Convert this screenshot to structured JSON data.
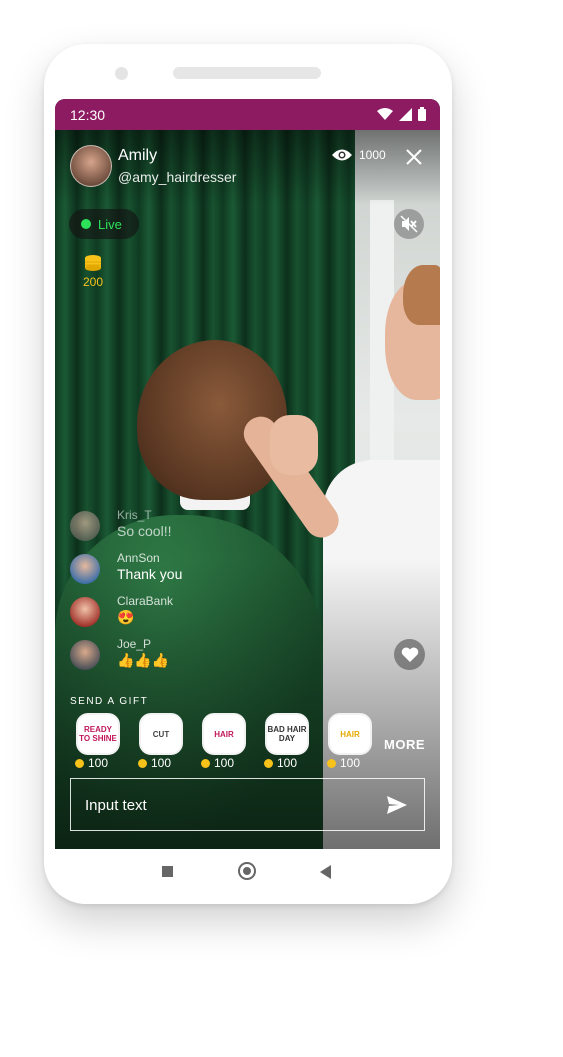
{
  "status_bar": {
    "time": "12:30"
  },
  "streamer": {
    "name": "Amily",
    "handle": "@amy_hairdresser"
  },
  "viewers": {
    "count": "1000",
    "icon": "eye-icon"
  },
  "live_badge": {
    "label": "Live",
    "color": "#2de25a"
  },
  "coins": {
    "amount": "200",
    "icon": "coin-stack-icon",
    "color": "#f7c21a"
  },
  "chat": [
    {
      "user": "Kris_T",
      "message": "So cool!!"
    },
    {
      "user": "AnnSon",
      "message": "Thank you"
    },
    {
      "user": "ClaraBank",
      "message": "😍"
    },
    {
      "user": "Joe_P",
      "message": "👍👍👍"
    }
  ],
  "gifts": {
    "title": "SEND A GIFT",
    "items": [
      {
        "sticker": "READY TO SHINE",
        "price": "100"
      },
      {
        "sticker": "CUT",
        "price": "100"
      },
      {
        "sticker": "HAIR",
        "price": "100"
      },
      {
        "sticker": "BAD HAIR DAY",
        "price": "100"
      },
      {
        "sticker": "HAIR",
        "price": "100"
      }
    ],
    "more_label": "MORE"
  },
  "input": {
    "placeholder": "Input text"
  },
  "colors": {
    "status_bar": "#8c1b62",
    "accent_green": "#2de25a",
    "coin": "#f7c21a"
  }
}
